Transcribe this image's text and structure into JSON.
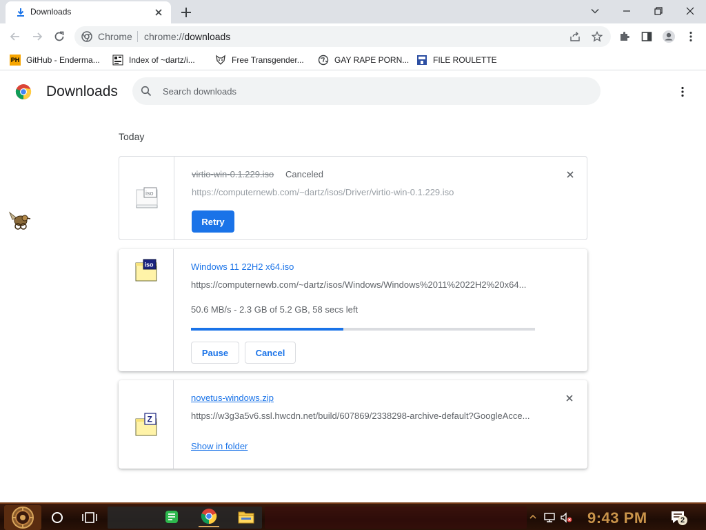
{
  "tab": {
    "title": "Downloads"
  },
  "toolbar": {
    "site_chip": "Chrome",
    "url_scheme": "chrome://",
    "url_path": "downloads"
  },
  "bookmarks": [
    {
      "label": "GitHub - Enderma...",
      "icon": "ph-icon"
    },
    {
      "label": "Index of ~dartz/i...",
      "icon": "directory-icon"
    },
    {
      "label": "Free Transgender...",
      "icon": "fox-icon"
    },
    {
      "label": "GAY RAPE PORN...",
      "icon": "globe-icon"
    },
    {
      "label": "FILE ROULETTE",
      "icon": "mft-icon"
    }
  ],
  "page": {
    "title": "Downloads",
    "search_placeholder": "Search downloads",
    "date_heading": "Today"
  },
  "downloads": [
    {
      "name": "virtio-win-0.1.229.iso",
      "status": "Canceled",
      "url": "https://computernewb.com/~dartz/isos/Driver/virtio-win-0.1.229.iso",
      "action": "Retry",
      "icon": "iso-file-icon"
    },
    {
      "name": "Windows 11 22H2 x64.iso",
      "url": "https://computernewb.com/~dartz/isos/Windows/Windows%2011%2022H2%20x64...",
      "progress_text": "50.6 MB/s - 2.3 GB of 5.2 GB, 58 secs left",
      "progress_fraction": 0.442,
      "pause_label": "Pause",
      "cancel_label": "Cancel",
      "icon": "iso-file-icon"
    },
    {
      "name": "novetus-windows.zip",
      "url": "https://w3g3a5v6.ssl.hwcdn.net/build/607869/2338298-archive-default?GoogleAcce...",
      "link_label": "Show in folder",
      "icon": "zip-file-icon"
    }
  ],
  "taskbar": {
    "clock": "9:43 PM",
    "notification_count": "2"
  },
  "colors": {
    "accent": "#1a73e8",
    "clock": "#c9934a"
  }
}
